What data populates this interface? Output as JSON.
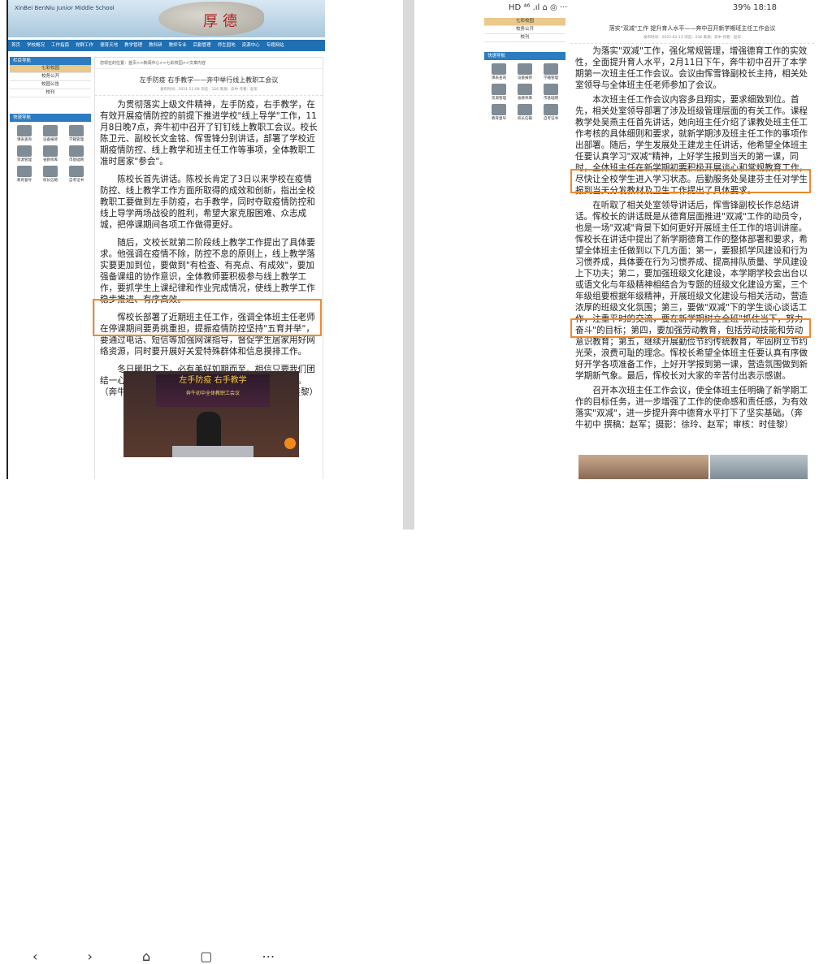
{
  "left": {
    "school_name": "XinBei BenNiu Junior Middle School",
    "header_calligraphy": "厚德",
    "nav": [
      "首页",
      "学校概况",
      "工作指南",
      "党群工作",
      "德育天地",
      "教学管理",
      "教科研",
      "教师专业",
      "后勤管理",
      "师生园地",
      "资源中心",
      "专题网站"
    ],
    "sidebar_title": "栏目导航",
    "sidebar_items": [
      "七彩校园",
      "校务公开",
      "校园公告",
      "校刊"
    ],
    "quick_title": "快速导航",
    "quick_items": [
      "课表查询",
      "设备报修",
      "学籍管理",
      "资源管理",
      "省教师库",
      "市基础网",
      "教育督导",
      "校长信箱",
      "自考证书"
    ],
    "breadcrumb": "您现在的位置：首页>>新闻中心>>七彩校园>>文章内容",
    "title": "左手防疫 右手教学——奔中举行线上教职工会议",
    "meta": "发布时间：2021-11-09  浏览：126  来源：奔中  作者：赵军",
    "paragraphs": [
      "为贯彻落实上级文件精神，左手防疫，右手教学，在有效开展疫情防控的前提下推进学校\"线上导学\"工作，11月8日晚7点，奔牛初中召开了钉钉线上教职工会议。校长陈卫元、副校长文金铭、恽雪锋分别讲话，部署了学校近期疫情防控、线上教学和班主任工作等事项，全体教职工准时居家\"参会\"。",
      "陈校长首先讲话。陈校长肯定了3日以来学校在疫情防控、线上教学工作方面所取得的成效和创新，指出全校教职工要做到左手防疫，右手教学，同时夺取疫情防控和线上导学两场战役的胜利，希望大家克服困难、众志成城，把停课期间各项工作做得更好。",
      "随后，文校长就第二阶段线上教学工作提出了具体要求。他强调在疫情不除，防控不息的原则上，线上教学落实要更加到位，要做到\"有检查、有亮点、有成效\"，要加强备课组的协作意识，全体教师要积极参与线上教学工作，要抓学生上课纪律和作业完成情况，使线上教学工作稳步推进、有序高效。",
      "恽校长部署了近期班主任工作，强调全体班主任老师在停课期间要勇挑重担，提振疫情防控坚持\"五育并举\"，要通过电话、短信等加强网课指导，督促学生居家用好网络资源，同时要开展好关爱特殊群体和信息摸排工作。",
      "冬日暖阳之下，必有美好如期而至。相信只要我们团结一心，砥砺奋进，终有一天，阳光甚好，花开人笑。（奔牛初中 撰稿：赵军；摄影：李江龙；审核：时佳黎）"
    ],
    "photo_banner": "左手防疫 右手教学",
    "photo_sub": "奔牛初中全体教职工会议"
  },
  "right": {
    "status_left": "HD ⁴⁶ .ıl ⌂ ◎ ···",
    "status_right": "39%  18:18",
    "sidebar_items": [
      "七彩校园",
      "校务公开",
      "校刊"
    ],
    "quick_title": "快速导航",
    "quick_items": [
      "课表查询",
      "设备报修",
      "学籍管理",
      "资源管理",
      "省教师库",
      "市基础网",
      "教育督导",
      "校长信箱",
      "自考证书"
    ],
    "title": "落实\"双减\"工作 提升育人水平——奔中召开新学期班主任工作会议",
    "meta": "发布时间：2022-02-13  浏览：236  来源：奔中  作者：赵军",
    "paragraphs": [
      "为落实\"双减\"工作，强化常规管理，增强德育工作的实效性，全面提升育人水平，2月11日下午，奔牛初中召开了本学期第一次班主任工作会议。会议由恽雪锋副校长主持，相关处室领导与全体班主任老师参加了会议。",
      "本次班主任工作会议内容多且翔实，要求细致到位。首先，相关处室领导部署了涉及班级管理层面的有关工作。课程教学处吴燕主任首先讲话，她向班主任介绍了课教处班主任工作考核的具体细则和要求，就新学期涉及班主任工作的事项作出部署。随后，学生发展处王建龙主任讲话，他希望全体班主任要认真学习\"双减\"精神，上好学生报到当天的第一课，同时，全体班主任在新学期初要积极开展谈心和常规教育工作，尽快让全校学生进入学习状态。后勤服务处吴建芬主任对学生报到当天分发教材及卫生工作提出了具体要求。",
      "在听取了相关处室领导讲话后，恽雪锋副校长作总结讲话。恽校长的讲话既是从德育层面推进\"双减\"工作的动员令，也是一场\"双减\"背景下如何更好开展班主任工作的培训讲座。恽校长在讲话中提出了新学期德育工作的整体部署和要求，希望全体班主任做到以下几方面：第一，要狠抓学风建设和行为习惯养成，具体要在行为习惯养成、提高排队质量、学风建设上下功夫；第二，要加强班级文化建设，本学期学校会出台以或语文化与年级精神相结合为专题的班级文化建设方案，三个年级组要根据年级精神，开展班级文化建设与相关活动，营造浓厚的班级文化氛围；第三，要做\"双减\"下的学生谈心谈话工作，注重平时的交流，要在新学期树立全班\"抓住当下，努力奋斗\"的目标；第四，要加强劳动教育，包括劳动技能和劳动意识教育；第五，继续开展勤俭节约传统教育，牢固树立节约光荣，浪费可耻的理念。恽校长希望全体班主任要认真有序做好开学各项准备工作，上好开学报到第一课，营造氛围做到新学期新气象。最后，恽校长对大家的辛苦付出表示感谢。",
      "召开本次班主任工作会议，使全体班主任明确了新学期工作的目标任务，进一步增强了工作的使命感和责任感，为有效落实\"双减\"，进一步提升奔中德育水平打下了坚实基础。（奔牛初中 撰稿：赵军；摄影：徐玲、赵军；审核：时佳黎）"
    ]
  },
  "bottom_icons": "‹  ›  ⌂  ▢  ⋯"
}
